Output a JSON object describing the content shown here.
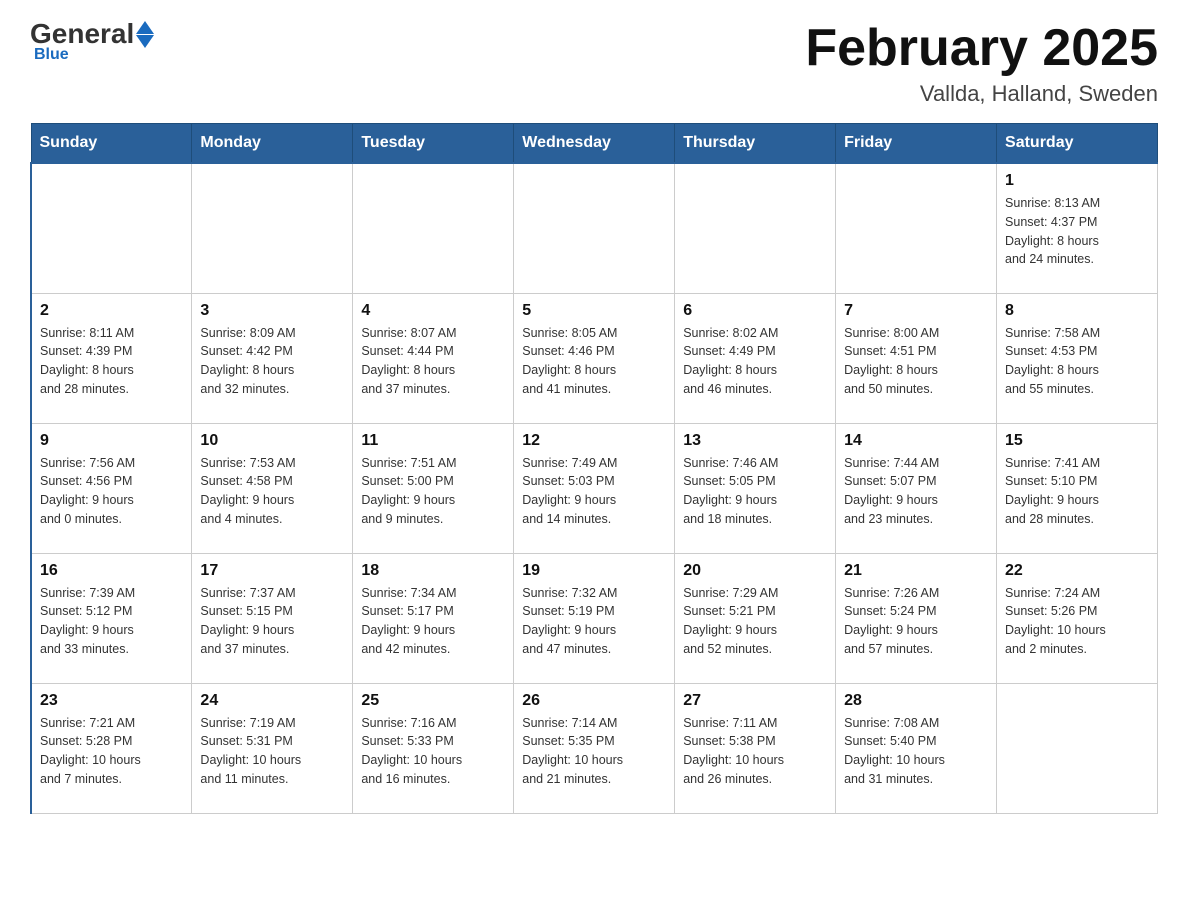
{
  "header": {
    "logo_general": "General",
    "logo_blue": "Blue",
    "month_title": "February 2025",
    "location": "Vallda, Halland, Sweden"
  },
  "days_of_week": [
    "Sunday",
    "Monday",
    "Tuesday",
    "Wednesday",
    "Thursday",
    "Friday",
    "Saturday"
  ],
  "weeks": [
    [
      {
        "day": "",
        "info": ""
      },
      {
        "day": "",
        "info": ""
      },
      {
        "day": "",
        "info": ""
      },
      {
        "day": "",
        "info": ""
      },
      {
        "day": "",
        "info": ""
      },
      {
        "day": "",
        "info": ""
      },
      {
        "day": "1",
        "info": "Sunrise: 8:13 AM\nSunset: 4:37 PM\nDaylight: 8 hours\nand 24 minutes."
      }
    ],
    [
      {
        "day": "2",
        "info": "Sunrise: 8:11 AM\nSunset: 4:39 PM\nDaylight: 8 hours\nand 28 minutes."
      },
      {
        "day": "3",
        "info": "Sunrise: 8:09 AM\nSunset: 4:42 PM\nDaylight: 8 hours\nand 32 minutes."
      },
      {
        "day": "4",
        "info": "Sunrise: 8:07 AM\nSunset: 4:44 PM\nDaylight: 8 hours\nand 37 minutes."
      },
      {
        "day": "5",
        "info": "Sunrise: 8:05 AM\nSunset: 4:46 PM\nDaylight: 8 hours\nand 41 minutes."
      },
      {
        "day": "6",
        "info": "Sunrise: 8:02 AM\nSunset: 4:49 PM\nDaylight: 8 hours\nand 46 minutes."
      },
      {
        "day": "7",
        "info": "Sunrise: 8:00 AM\nSunset: 4:51 PM\nDaylight: 8 hours\nand 50 minutes."
      },
      {
        "day": "8",
        "info": "Sunrise: 7:58 AM\nSunset: 4:53 PM\nDaylight: 8 hours\nand 55 minutes."
      }
    ],
    [
      {
        "day": "9",
        "info": "Sunrise: 7:56 AM\nSunset: 4:56 PM\nDaylight: 9 hours\nand 0 minutes."
      },
      {
        "day": "10",
        "info": "Sunrise: 7:53 AM\nSunset: 4:58 PM\nDaylight: 9 hours\nand 4 minutes."
      },
      {
        "day": "11",
        "info": "Sunrise: 7:51 AM\nSunset: 5:00 PM\nDaylight: 9 hours\nand 9 minutes."
      },
      {
        "day": "12",
        "info": "Sunrise: 7:49 AM\nSunset: 5:03 PM\nDaylight: 9 hours\nand 14 minutes."
      },
      {
        "day": "13",
        "info": "Sunrise: 7:46 AM\nSunset: 5:05 PM\nDaylight: 9 hours\nand 18 minutes."
      },
      {
        "day": "14",
        "info": "Sunrise: 7:44 AM\nSunset: 5:07 PM\nDaylight: 9 hours\nand 23 minutes."
      },
      {
        "day": "15",
        "info": "Sunrise: 7:41 AM\nSunset: 5:10 PM\nDaylight: 9 hours\nand 28 minutes."
      }
    ],
    [
      {
        "day": "16",
        "info": "Sunrise: 7:39 AM\nSunset: 5:12 PM\nDaylight: 9 hours\nand 33 minutes."
      },
      {
        "day": "17",
        "info": "Sunrise: 7:37 AM\nSunset: 5:15 PM\nDaylight: 9 hours\nand 37 minutes."
      },
      {
        "day": "18",
        "info": "Sunrise: 7:34 AM\nSunset: 5:17 PM\nDaylight: 9 hours\nand 42 minutes."
      },
      {
        "day": "19",
        "info": "Sunrise: 7:32 AM\nSunset: 5:19 PM\nDaylight: 9 hours\nand 47 minutes."
      },
      {
        "day": "20",
        "info": "Sunrise: 7:29 AM\nSunset: 5:21 PM\nDaylight: 9 hours\nand 52 minutes."
      },
      {
        "day": "21",
        "info": "Sunrise: 7:26 AM\nSunset: 5:24 PM\nDaylight: 9 hours\nand 57 minutes."
      },
      {
        "day": "22",
        "info": "Sunrise: 7:24 AM\nSunset: 5:26 PM\nDaylight: 10 hours\nand 2 minutes."
      }
    ],
    [
      {
        "day": "23",
        "info": "Sunrise: 7:21 AM\nSunset: 5:28 PM\nDaylight: 10 hours\nand 7 minutes."
      },
      {
        "day": "24",
        "info": "Sunrise: 7:19 AM\nSunset: 5:31 PM\nDaylight: 10 hours\nand 11 minutes."
      },
      {
        "day": "25",
        "info": "Sunrise: 7:16 AM\nSunset: 5:33 PM\nDaylight: 10 hours\nand 16 minutes."
      },
      {
        "day": "26",
        "info": "Sunrise: 7:14 AM\nSunset: 5:35 PM\nDaylight: 10 hours\nand 21 minutes."
      },
      {
        "day": "27",
        "info": "Sunrise: 7:11 AM\nSunset: 5:38 PM\nDaylight: 10 hours\nand 26 minutes."
      },
      {
        "day": "28",
        "info": "Sunrise: 7:08 AM\nSunset: 5:40 PM\nDaylight: 10 hours\nand 31 minutes."
      },
      {
        "day": "",
        "info": ""
      }
    ]
  ]
}
